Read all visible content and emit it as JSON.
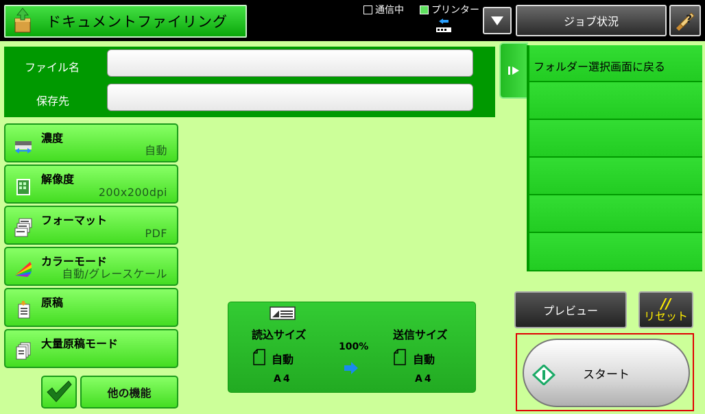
{
  "header": {
    "title": "ドキュメントファイリング",
    "comm_status": "通信中",
    "printer_status": "プリンター",
    "job_status_label": "ジョブ状況"
  },
  "file_panel": {
    "filename_label": "ファイル名",
    "filename_value": "",
    "destination_label": "保存先",
    "destination_value": ""
  },
  "functions": [
    {
      "name": "濃度",
      "value": "自動",
      "icon": "density-icon"
    },
    {
      "name": "解像度",
      "value": "200x200dpi",
      "icon": "resolution-icon"
    },
    {
      "name": "フォーマット",
      "value": "PDF",
      "icon": "format-icon"
    },
    {
      "name": "カラーモード",
      "value": "自動/グレースケール",
      "icon": "color-mode-icon"
    },
    {
      "name": "原稿",
      "value": "",
      "icon": "original-icon"
    },
    {
      "name": "大量原稿モード",
      "value": "",
      "icon": "mass-original-icon"
    }
  ],
  "other_functions_label": "他の機能",
  "size_panel": {
    "scan_size_label": "読込サイズ",
    "scan_size_mode": "自動",
    "scan_size_value": "A4",
    "ratio": "100%",
    "send_size_label": "送信サイズ",
    "send_size_mode": "自動",
    "send_size_value": "A4"
  },
  "folder_list": {
    "back_label": "フォルダー選択画面に戻る",
    "rows": [
      "",
      "",
      "",
      "",
      ""
    ]
  },
  "buttons": {
    "preview": "プレビュー",
    "reset": "リセット",
    "reset_glyph": "//",
    "start": "スタート"
  },
  "colors": {
    "background": "#ccff99",
    "panel_green": "#009900",
    "button_green": "#44dd22",
    "highlight_red": "#e00000"
  }
}
